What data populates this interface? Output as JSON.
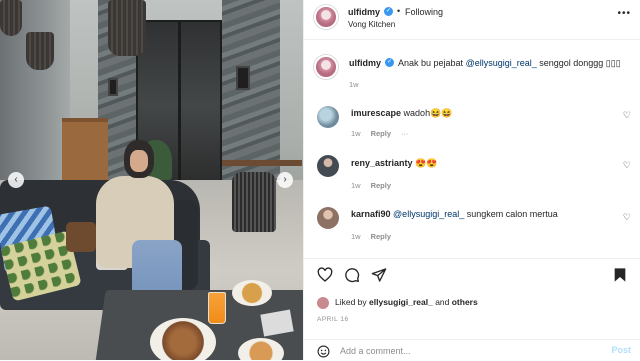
{
  "post": {
    "username": "ulfidmy",
    "follow_status": "Following",
    "dot": "•",
    "location": "Vong Kitchen",
    "more_icon": "more-icon"
  },
  "caption": {
    "username": "ulfidmy",
    "text_before": "Anak bu pejabat ",
    "mention": "@ellysugigi_real_",
    "text_after": " senggol donggg ▯▯▯",
    "time": "1w"
  },
  "comments": [
    {
      "username": "imurescape",
      "text": "wadoh😆😆",
      "time": "1w",
      "reply": "Reply",
      "more": "···",
      "avatar_color": "#6e8a9c"
    },
    {
      "username": "reny_astrianty",
      "text": "😍😍",
      "time": "1w",
      "reply": "Reply",
      "more": "",
      "avatar_color": "#444a52"
    },
    {
      "username": "karnafi90",
      "mention": "@ellysugigi_real_",
      "text": " sungkem calon mertua",
      "time": "1w",
      "reply": "Reply",
      "more": "",
      "avatar_color": "#8c7164"
    }
  ],
  "likes": {
    "prefix": "Liked by ",
    "user": "ellysugigi_real_",
    "middle": " and ",
    "others": "others"
  },
  "date": "APRIL 16",
  "add_comment": {
    "placeholder": "Add a comment...",
    "post_label": "Post"
  },
  "nav": {
    "prev": "‹",
    "next": "›"
  },
  "colors": {
    "link": "#00376b",
    "verified": "#3897f0",
    "muted": "#8e8e8e",
    "post_disabled": "#b2dffc"
  }
}
